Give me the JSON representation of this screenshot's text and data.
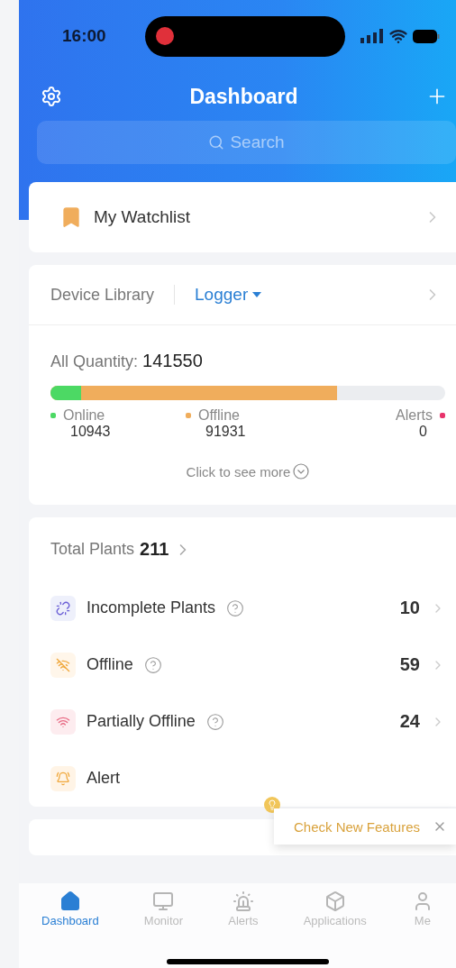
{
  "status_bar": {
    "time": "16:00",
    "recording": true
  },
  "header": {
    "title": "Dashboard"
  },
  "search": {
    "placeholder": "Search"
  },
  "watchlist": {
    "label": "My Watchlist"
  },
  "device_library": {
    "title": "Device Library",
    "type": "Logger",
    "quantity_label": "All Quantity:",
    "quantity": "141550",
    "segments": [
      {
        "level": 0.077,
        "color": "#4cd964"
      },
      {
        "level": 0.727,
        "color": "#f0ad5c"
      }
    ],
    "legend": [
      {
        "label": "Online",
        "value": "10943",
        "color": "#4cd964"
      },
      {
        "label": "Offline",
        "value": "91931",
        "color": "#f0ad5c"
      },
      {
        "label": "Alerts",
        "value": "0",
        "color": "#e8336b"
      }
    ],
    "more": "Click to see more"
  },
  "plants": {
    "label": "Total Plants",
    "total": "211",
    "rows": [
      {
        "kind": "incomplete",
        "label": "Incomplete Plants",
        "value": "10",
        "help": true
      },
      {
        "kind": "offline",
        "label": "Offline",
        "value": "59",
        "help": true
      },
      {
        "kind": "partial",
        "label": "Partially Offline",
        "value": "24",
        "help": true
      },
      {
        "kind": "alert",
        "label": "Alert",
        "help": false
      }
    ]
  },
  "tooltip": {
    "label": "Check New Features"
  },
  "tab_bar": [
    {
      "label": "Dashboard",
      "kind": "home",
      "selected": true
    },
    {
      "label": "Monitor",
      "kind": "monitor",
      "selected": false
    },
    {
      "label": "Alerts",
      "kind": "alerts",
      "selected": false
    },
    {
      "label": "Applications",
      "kind": "apps",
      "selected": false
    },
    {
      "label": "Me",
      "kind": "me",
      "selected": false
    }
  ]
}
